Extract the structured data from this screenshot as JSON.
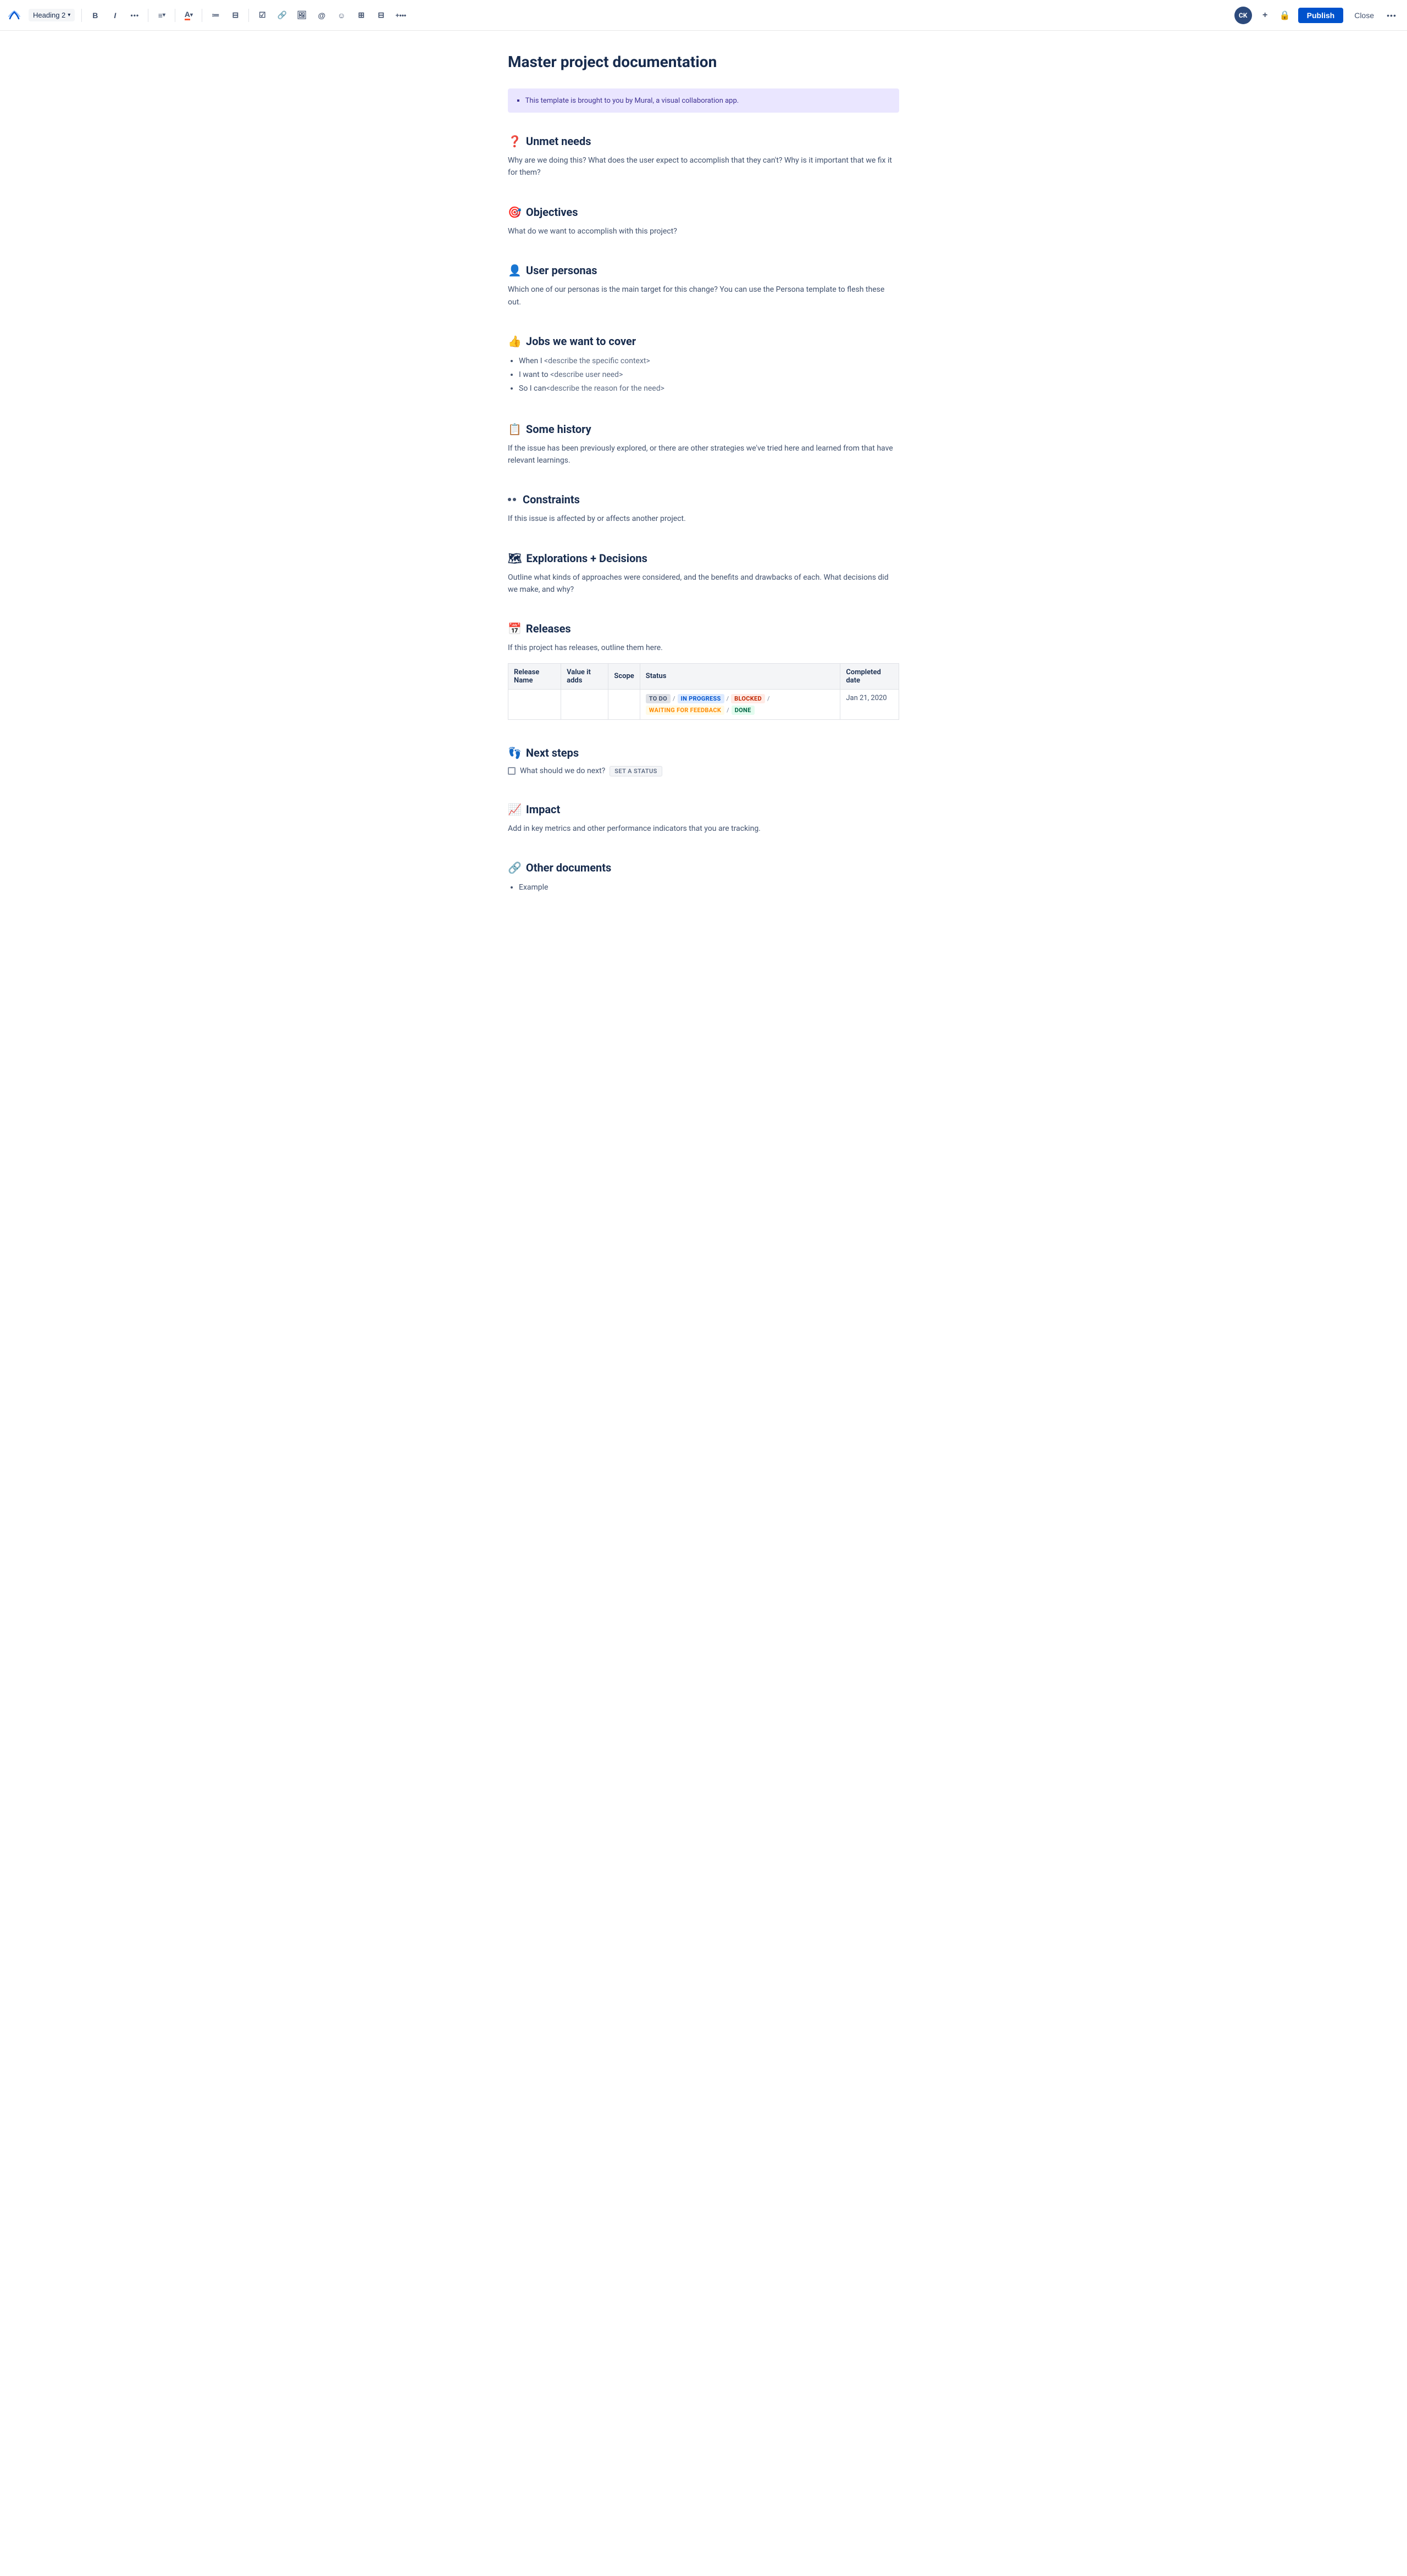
{
  "toolbar": {
    "logo_label": "Confluence logo",
    "heading_select": "Heading 2",
    "chevron": "▾",
    "bold": "B",
    "italic": "I",
    "more_format": "•••",
    "align": "≡",
    "align_chevron": "▾",
    "text_color": "A",
    "text_color_chevron": "▾",
    "bullet_list": "☰",
    "numbered_list": "☰",
    "task_list": "☑",
    "link": "🔗",
    "image": "🖼",
    "mention": "@",
    "emoji": "☺",
    "table": "⊞",
    "layout": "⊟",
    "insert_more": "+•••",
    "avatar_initials": "CK",
    "add_icon": "+",
    "lock_icon": "🔒",
    "publish_label": "Publish",
    "close_label": "Close",
    "more_actions": "•••"
  },
  "page": {
    "title": "Master project documentation"
  },
  "info_banner": {
    "icon": "▪",
    "text": "This template is brought to you by Mural, a visual collaboration app."
  },
  "sections": [
    {
      "id": "unmet-needs",
      "emoji": "❓",
      "heading": "Unmet needs",
      "text": "Why are we doing this? What does the user expect to accomplish that they can't? Why is it important that we fix it for them?"
    },
    {
      "id": "objectives",
      "emoji": "🎯",
      "heading": "Objectives",
      "text": "What do we want to accomplish with this project?"
    },
    {
      "id": "user-personas",
      "emoji": "👤",
      "heading": "User personas",
      "text": "Which one of our personas is the main target for this change? You can use the Persona template to flesh these out."
    },
    {
      "id": "jobs",
      "emoji": "👍",
      "heading": "Jobs we want to cover",
      "bullets": [
        "When I <describe the specific context>",
        "I want to <describe user need>",
        "So I can <describe the reason for the need>"
      ]
    },
    {
      "id": "some-history",
      "emoji": "📋",
      "heading": "Some history",
      "text": "If the issue has been previously explored, or there are other strategies we've tried here and learned from that have relevant learnings."
    },
    {
      "id": "constraints",
      "emoji": "constraints-dots",
      "heading": "Constraints",
      "text": "If this issue is affected by or affects another project."
    },
    {
      "id": "explorations",
      "emoji": "🗺",
      "heading": "Explorations + Decisions",
      "text": "Outline what kinds of approaches were considered, and the benefits and drawbacks of each. What decisions did we make, and why?"
    }
  ],
  "releases": {
    "emoji": "📅",
    "heading": "Releases",
    "text": "If this project has releases, outline them here.",
    "table": {
      "columns": [
        "Release Name",
        "Value it adds",
        "Scope",
        "Status",
        "Completed date"
      ],
      "rows": [
        {
          "release_name": "",
          "value_adds": "",
          "scope": "",
          "status_badges": [
            {
              "label": "TO DO",
              "type": "todo"
            },
            {
              "sep": "/"
            },
            {
              "label": "IN PROGRESS",
              "type": "inprogress"
            },
            {
              "sep": "/"
            },
            {
              "label": "BLOCKED",
              "type": "blocked"
            },
            {
              "sep": "/"
            },
            {
              "label": "WAITING FOR FEEDBACK",
              "type": "waiting"
            },
            {
              "sep": "/"
            },
            {
              "label": "DONE",
              "type": "done"
            }
          ],
          "completed_date": "Jan 21, 2020"
        }
      ]
    }
  },
  "next_steps": {
    "emoji": "👣",
    "heading": "Next steps",
    "checkbox_label": "What should we do next?",
    "set_status": "SET A STATUS"
  },
  "impact": {
    "emoji": "📈",
    "heading": "Impact",
    "text": "Add in key metrics and other performance indicators that you are tracking."
  },
  "other_documents": {
    "emoji": "🔗",
    "heading": "Other documents",
    "bullets": [
      "Example"
    ]
  }
}
